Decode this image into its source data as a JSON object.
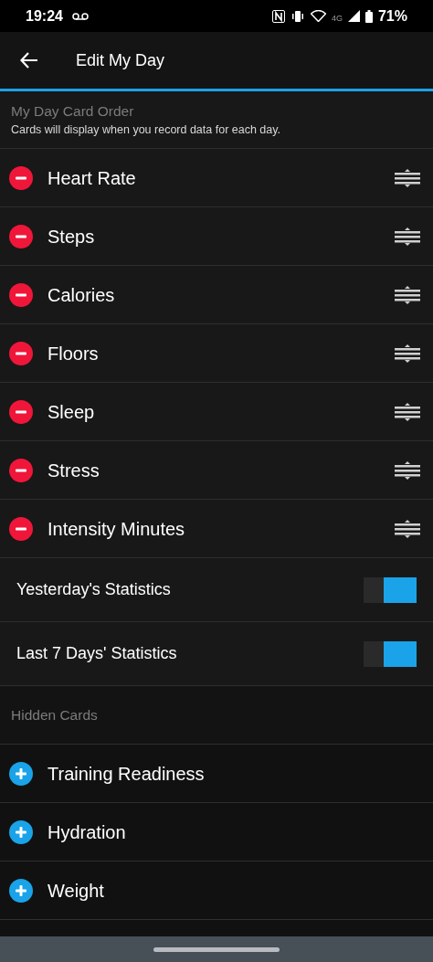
{
  "status_bar": {
    "time": "19:24",
    "network": "4G",
    "battery": "71%"
  },
  "header": {
    "title": "Edit My Day"
  },
  "card_order": {
    "title": "My Day Card Order",
    "subtitle": "Cards will display when you record data for each day.",
    "cards": [
      {
        "label": "Heart Rate"
      },
      {
        "label": "Steps"
      },
      {
        "label": "Calories"
      },
      {
        "label": "Floors"
      },
      {
        "label": "Sleep"
      },
      {
        "label": "Stress"
      },
      {
        "label": "Intensity Minutes"
      }
    ]
  },
  "settings": [
    {
      "label": "Yesterday's Statistics",
      "on": true
    },
    {
      "label": "Last 7 Days' Statistics",
      "on": true
    }
  ],
  "hidden_cards": {
    "title": "Hidden Cards",
    "cards": [
      {
        "label": "Training Readiness"
      },
      {
        "label": "Hydration"
      },
      {
        "label": "Weight"
      }
    ]
  }
}
